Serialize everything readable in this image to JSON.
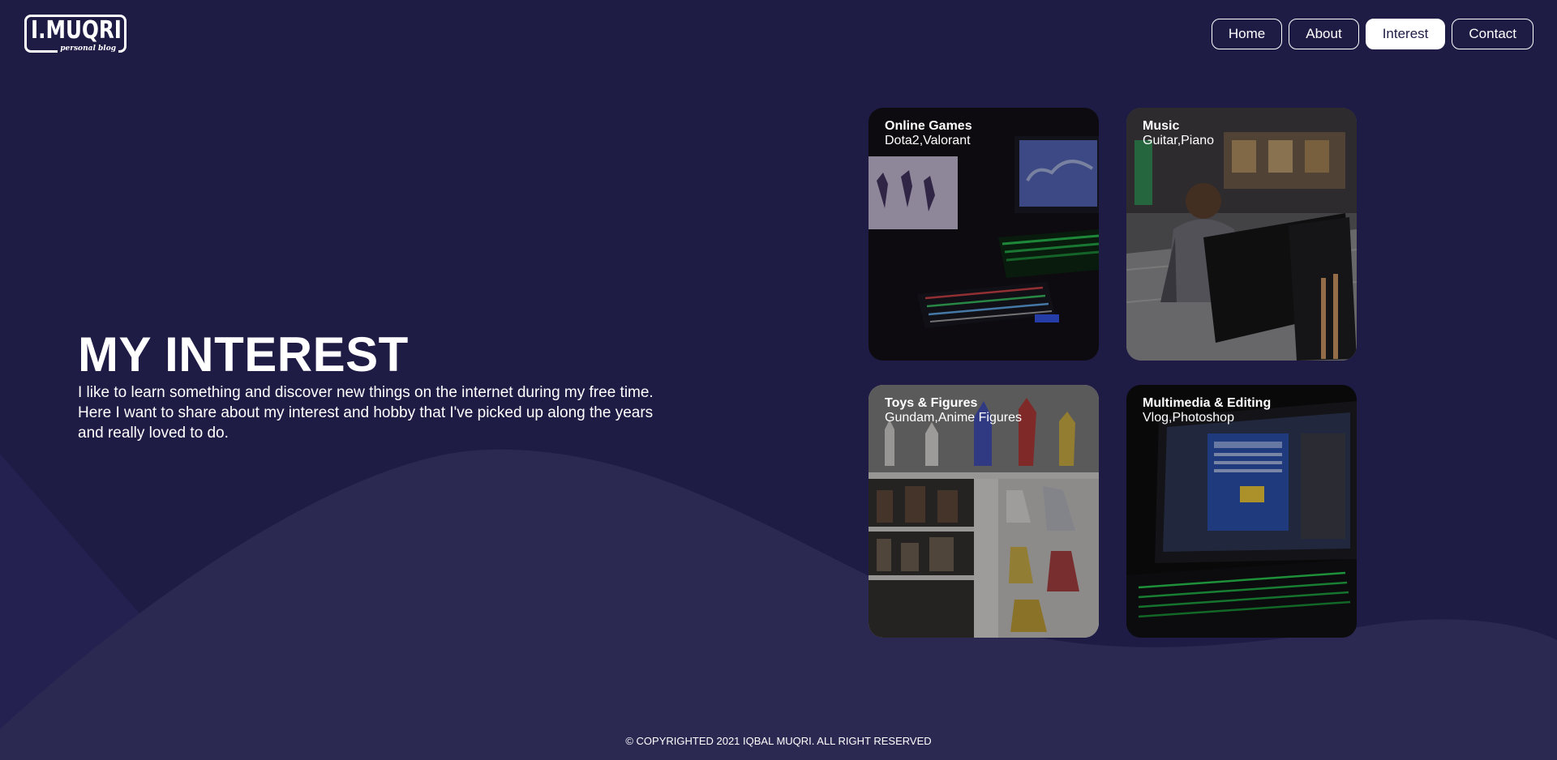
{
  "colors": {
    "background": "#1e1b45",
    "wave": "#2b2852",
    "accent_white": "#ffffff"
  },
  "logo": {
    "name": "I.MUQRI",
    "tagline": "personal blog"
  },
  "nav": {
    "items": [
      {
        "label": "Home",
        "active": false
      },
      {
        "label": "About",
        "active": false
      },
      {
        "label": "Interest",
        "active": true
      },
      {
        "label": "Contact",
        "active": false
      }
    ]
  },
  "hero": {
    "title": "MY INTEREST",
    "description": "I like to learn something and discover new things on the internet during my free time. Here I want to share about my interest and hobby that I've picked up along the years and really loved to do."
  },
  "cards": [
    {
      "title": "Online Games",
      "subtitle": "Dota2,Valorant",
      "image": "gaming-setup-photo"
    },
    {
      "title": "Music",
      "subtitle": "Guitar,Piano",
      "image": "piano-player-photo"
    },
    {
      "title": "Toys & Figures",
      "subtitle": "Gundam,Anime Figures",
      "image": "figures-shelf-photo"
    },
    {
      "title": "Multimedia & Editing",
      "subtitle": "Vlog,Photoshop",
      "image": "laptop-editing-photo"
    }
  ],
  "footer": {
    "copyright": "© COPYRIGHTED 2021 IQBAL MUQRI. ALL RIGHT RESERVED"
  }
}
